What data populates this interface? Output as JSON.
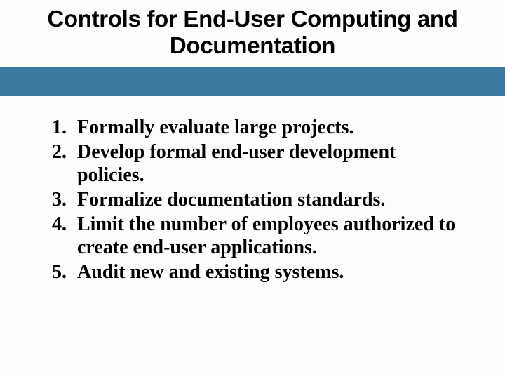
{
  "title": "Controls for End-User Computing and Documentation",
  "items": [
    "Formally evaluate large projects.",
    "Develop formal end-user development policies.",
    "Formalize documentation standards.",
    "Limit the number of employees authorized to create end-user applications.",
    "Audit new and existing systems."
  ]
}
